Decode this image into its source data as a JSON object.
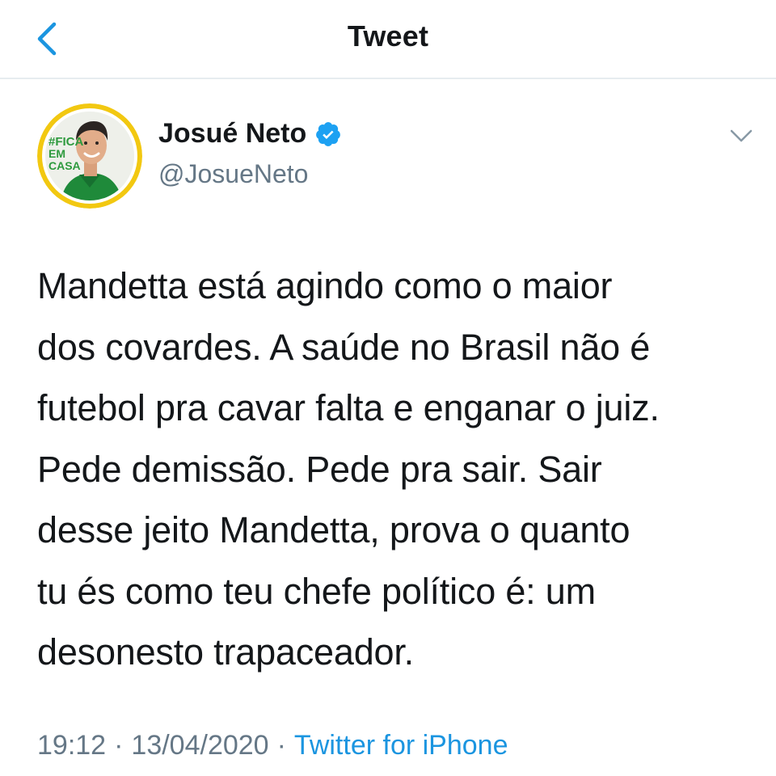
{
  "header": {
    "title": "Tweet",
    "back_icon": "chevron-left-icon"
  },
  "colors": {
    "accent": "#1b95e0",
    "text": "#14171a",
    "secondary": "#657786",
    "divider": "#e6ecf0",
    "verified": "#1da1f2"
  },
  "author": {
    "name": "Josué Neto",
    "handle": "@JosueNeto",
    "verified": true,
    "avatar_text": [
      "#FICA",
      "EM",
      "CASA"
    ]
  },
  "tweet": {
    "text": "Mandetta está agindo como o maior\ndos covardes. A saúde no Brasil não é\nfutebol pra cavar falta e enganar o juiz.\nPede demissão. Pede pra sair. Sair\ndesse jeito Mandetta, prova o quanto\ntu és como teu chefe político é: um\ndesonesto trapaceador.",
    "time": "19:12",
    "date": "13/04/2020",
    "separator": "·",
    "source": "Twitter for iPhone"
  }
}
